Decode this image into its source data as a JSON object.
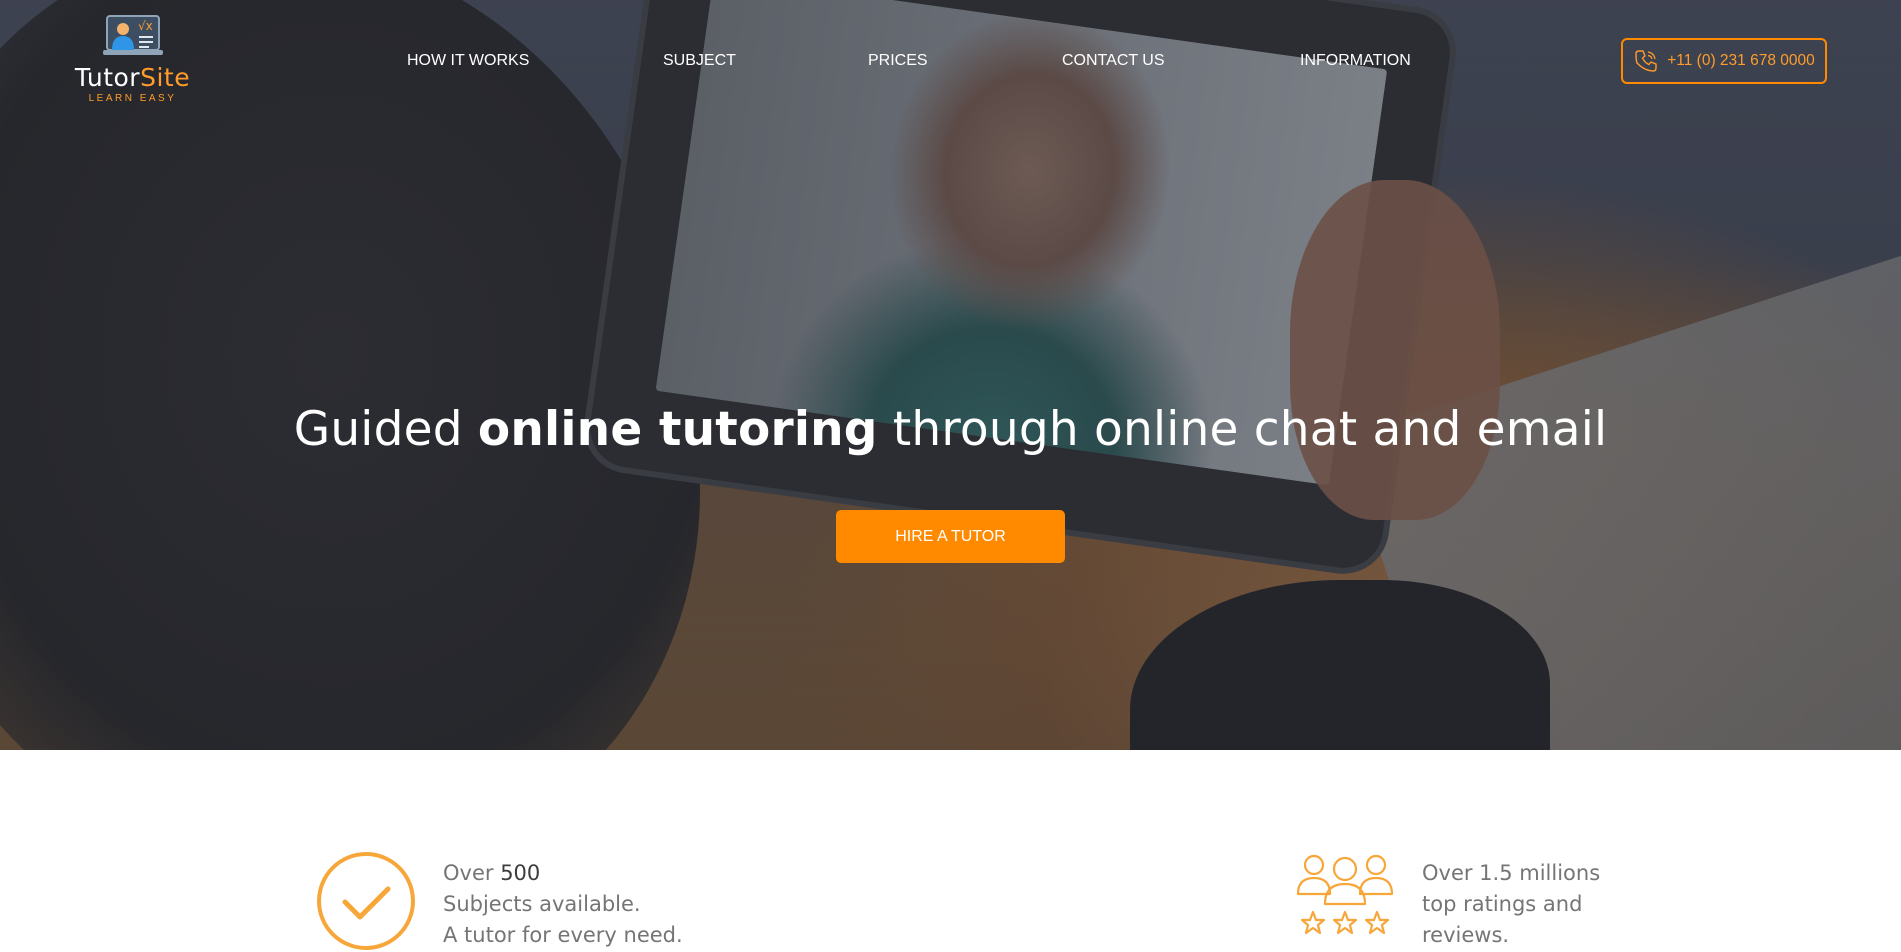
{
  "logo": {
    "name_main": "Tutor",
    "name_accent": "Site",
    "tagline": "LEARN EASY"
  },
  "nav": {
    "items": [
      {
        "label": "HOW IT WORKS"
      },
      {
        "label": "SUBJECT"
      },
      {
        "label": "PRICES"
      },
      {
        "label": "CONTACT US"
      },
      {
        "label": "INFORMATION"
      }
    ],
    "phone": "+11 (0) 231 678 0000"
  },
  "hero": {
    "title_pre": "Guided ",
    "title_strong": "online tutoring",
    "title_post": " through online chat and email",
    "cta": "HIRE A TUTOR"
  },
  "features": [
    {
      "icon": "checkmark-circle-icon",
      "prefix": "Over ",
      "strong": "500",
      "line2": "Subjects available.",
      "line3": "A tutor for every need."
    },
    {
      "icon": "rated-people-icon",
      "prefix": "Over 1.5 millions",
      "strong": "",
      "line2": "top ratings and",
      "line3": "reviews."
    }
  ],
  "colors": {
    "accent": "#ff8a00",
    "accent_text": "#ff9c2a",
    "feature_text": "#757575"
  }
}
